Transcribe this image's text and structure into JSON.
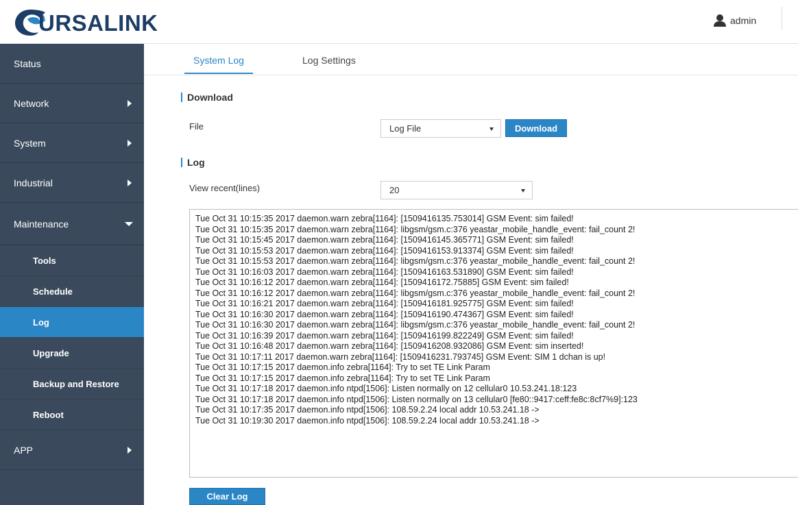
{
  "header": {
    "brand": "URSALINK",
    "user": "admin",
    "brand_color": "#1c3d66"
  },
  "sidebar": {
    "items": [
      {
        "label": "Status",
        "arrow": "none"
      },
      {
        "label": "Network",
        "arrow": "right"
      },
      {
        "label": "System",
        "arrow": "right"
      },
      {
        "label": "Industrial",
        "arrow": "right"
      },
      {
        "label": "Maintenance",
        "arrow": "down"
      }
    ],
    "sub_items": [
      {
        "label": "Tools",
        "active": false
      },
      {
        "label": "Schedule",
        "active": false
      },
      {
        "label": "Log",
        "active": true
      },
      {
        "label": "Upgrade",
        "active": false
      },
      {
        "label": "Backup and Restore",
        "active": false
      },
      {
        "label": "Reboot",
        "active": false
      }
    ],
    "app": {
      "label": "APP"
    },
    "bg_color": "#3a4a5c",
    "active_color": "#2b86c6"
  },
  "tabs": [
    {
      "label": "System Log",
      "active": true
    },
    {
      "label": "Log Settings",
      "active": false
    }
  ],
  "download": {
    "title": "Download",
    "file_label": "File",
    "file_value": "Log File",
    "button": "Download"
  },
  "log": {
    "title": "Log",
    "recent_label": "View recent(lines)",
    "recent_value": "20",
    "lines": [
      "Tue Oct 31 10:15:35 2017 daemon.warn zebra[1164]: [1509416135.753014] GSM Event: sim failed!",
      "Tue Oct 31 10:15:35 2017 daemon.warn zebra[1164]: libgsm/gsm.c:376 yeastar_mobile_handle_event: fail_count 2!",
      "Tue Oct 31 10:15:45 2017 daemon.warn zebra[1164]: [1509416145.365771] GSM Event: sim failed!",
      "Tue Oct 31 10:15:53 2017 daemon.warn zebra[1164]: [1509416153.913374] GSM Event: sim failed!",
      "Tue Oct 31 10:15:53 2017 daemon.warn zebra[1164]: libgsm/gsm.c:376 yeastar_mobile_handle_event: fail_count 2!",
      "Tue Oct 31 10:16:03 2017 daemon.warn zebra[1164]: [1509416163.531890] GSM Event: sim failed!",
      "Tue Oct 31 10:16:12 2017 daemon.warn zebra[1164]: [1509416172.75885] GSM Event: sim failed!",
      "Tue Oct 31 10:16:12 2017 daemon.warn zebra[1164]: libgsm/gsm.c:376 yeastar_mobile_handle_event: fail_count 2!",
      "Tue Oct 31 10:16:21 2017 daemon.warn zebra[1164]: [1509416181.925775] GSM Event: sim failed!",
      "Tue Oct 31 10:16:30 2017 daemon.warn zebra[1164]: [1509416190.474367] GSM Event: sim failed!",
      "Tue Oct 31 10:16:30 2017 daemon.warn zebra[1164]: libgsm/gsm.c:376 yeastar_mobile_handle_event: fail_count 2!",
      "Tue Oct 31 10:16:39 2017 daemon.warn zebra[1164]: [1509416199.822249] GSM Event: sim failed!",
      "Tue Oct 31 10:16:48 2017 daemon.warn zebra[1164]: [1509416208.932086] GSM Event: sim inserted!",
      "Tue Oct 31 10:17:11 2017 daemon.warn zebra[1164]: [1509416231.793745] GSM Event: SIM 1 dchan is up!",
      "Tue Oct 31 10:17:15 2017 daemon.info zebra[1164]: Try to set TE Link Param",
      "Tue Oct 31 10:17:15 2017 daemon.info zebra[1164]: Try to set TE Link Param",
      "Tue Oct 31 10:17:18 2017 daemon.info ntpd[1506]: Listen normally on 12 cellular0 10.53.241.18:123",
      "Tue Oct 31 10:17:18 2017 daemon.info ntpd[1506]: Listen normally on 13 cellular0 [fe80::9417:ceff:fe8c:8cf7%9]:123",
      "Tue Oct 31 10:17:35 2017 daemon.info ntpd[1506]: 108.59.2.24 local addr 10.53.241.18 ->",
      "Tue Oct 31 10:19:30 2017 daemon.info ntpd[1506]: 108.59.2.24 local addr 10.53.241.18 ->"
    ],
    "clear_button": "Clear Log"
  },
  "icons": {
    "logo": "bear-logo-icon",
    "user": "user-icon",
    "arrow_right": "caret-right-icon",
    "arrow_down": "caret-down-icon",
    "select_caret": "caret-down-icon"
  }
}
